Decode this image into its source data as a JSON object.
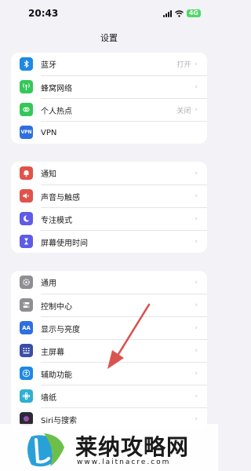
{
  "status_bar": {
    "time": "20:43",
    "battery": "4G"
  },
  "header": {
    "title": "设置"
  },
  "groups": [
    {
      "items": [
        {
          "label": "蓝牙",
          "value": "打开",
          "icon": "bluetooth-icon",
          "color": "#1e88e5"
        },
        {
          "label": "蜂窝网络",
          "value": "",
          "icon": "cellular-icon",
          "color": "#34c759"
        },
        {
          "label": "个人热点",
          "value": "关闭",
          "icon": "hotspot-icon",
          "color": "#34c759"
        },
        {
          "label": "VPN",
          "value": "",
          "icon": "vpn-icon",
          "icon_text": "VPN",
          "color": "#2f6fdf"
        }
      ]
    },
    {
      "items": [
        {
          "label": "通知",
          "value": "",
          "icon": "bell-icon",
          "color": "#e0534a"
        },
        {
          "label": "声音与触感",
          "value": "",
          "icon": "speaker-icon",
          "color": "#e0534a"
        },
        {
          "label": "专注模式",
          "value": "",
          "icon": "moon-icon",
          "color": "#5e5ce6"
        },
        {
          "label": "屏幕使用时间",
          "value": "",
          "icon": "hourglass-icon",
          "color": "#5e5ce6"
        }
      ]
    },
    {
      "items": [
        {
          "label": "通用",
          "value": "",
          "icon": "gear-icon",
          "color": "#8e8e93"
        },
        {
          "label": "控制中心",
          "value": "",
          "icon": "toggles-icon",
          "color": "#8e8e93"
        },
        {
          "label": "显示与亮度",
          "value": "",
          "icon": "display-icon",
          "icon_text": "AA",
          "color": "#2f6fdf"
        },
        {
          "label": "主屏幕",
          "value": "",
          "icon": "home-screen-icon",
          "color": "#3a4ea8"
        },
        {
          "label": "辅助功能",
          "value": "",
          "icon": "accessibility-icon",
          "color": "#1e88e5"
        },
        {
          "label": "墙纸",
          "value": "",
          "icon": "wallpaper-icon",
          "color": "#30b0d0"
        },
        {
          "label": "Siri与搜索",
          "value": "",
          "icon": "siri-icon",
          "color": "#2a2a3a"
        }
      ]
    }
  ],
  "watermark": {
    "text": "莱纳攻略网",
    "url": "www.laitnacre.com"
  }
}
